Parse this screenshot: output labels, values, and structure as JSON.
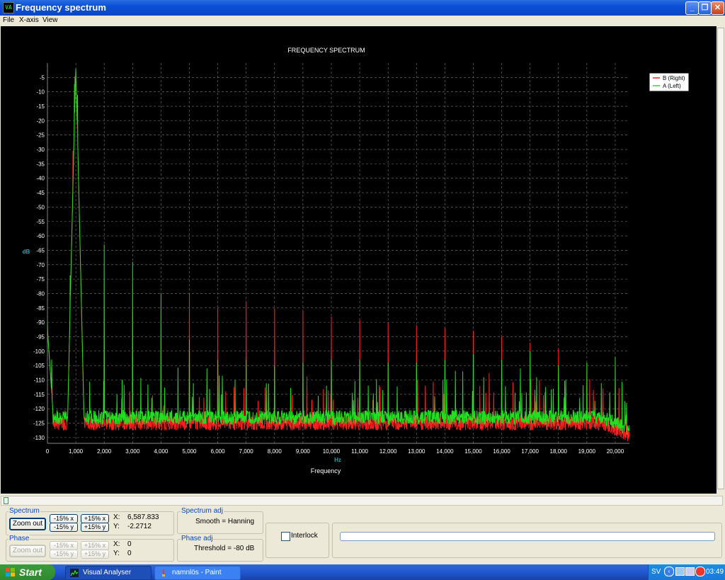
{
  "window": {
    "title": "Frequency spectrum",
    "minimize": "_",
    "maximize": "❐",
    "close": "✕",
    "app_icon": "VA"
  },
  "menu": [
    "File",
    "X-axis",
    "View"
  ],
  "chart_data": {
    "type": "line",
    "title": "FREQUENCY SPECTRUM",
    "xlabel": "Frequency",
    "x_unit": "Hz",
    "y_unit": "dB",
    "xlim": [
      0,
      20500
    ],
    "ylim": [
      -132,
      0
    ],
    "x_ticks": [
      0,
      1000,
      2000,
      3000,
      4000,
      5000,
      6000,
      7000,
      8000,
      9000,
      10000,
      11000,
      12000,
      13000,
      14000,
      15000,
      16000,
      17000,
      18000,
      19000,
      20000
    ],
    "x_tick_labels": [
      "0",
      "1,000",
      "2,000",
      "3,000",
      "4,000",
      "5,000",
      "6,000",
      "7,000",
      "8,000",
      "9,000",
      "10,000",
      "11,000",
      "12,000",
      "13,000",
      "14,000",
      "15,000",
      "16,000",
      "17,000",
      "18,000",
      "19,000",
      "20,000"
    ],
    "y_ticks": [
      -5,
      -10,
      -15,
      -20,
      -25,
      -30,
      -35,
      -40,
      -45,
      -50,
      -55,
      -60,
      -65,
      -70,
      -75,
      -80,
      -85,
      -90,
      -95,
      -100,
      -105,
      -110,
      -115,
      -120,
      -125,
      -130
    ],
    "grid": true,
    "legend_position": "top-right",
    "series": [
      {
        "name": "B (Right)",
        "color": "#ff2020",
        "noise_floor": -125,
        "peaks": [
          [
            0,
            -92
          ],
          [
            1000,
            -2
          ],
          [
            2000,
            -100
          ],
          [
            3000,
            -100
          ],
          [
            4000,
            -110
          ],
          [
            5000,
            -80
          ],
          [
            6000,
            -85
          ],
          [
            7000,
            -83
          ],
          [
            8000,
            -85
          ],
          [
            9000,
            -86
          ],
          [
            10000,
            -88
          ],
          [
            11000,
            -89
          ],
          [
            12000,
            -90
          ],
          [
            13000,
            -91
          ],
          [
            14000,
            -92
          ],
          [
            15000,
            -93
          ],
          [
            16000,
            -95
          ],
          [
            17000,
            -97
          ],
          [
            18000,
            -99
          ],
          [
            19000,
            -104
          ],
          [
            20000,
            -108
          ],
          [
            20400,
            -120
          ]
        ]
      },
      {
        "name": "A (Left)",
        "color": "#20e020",
        "noise_floor": -123,
        "peaks": [
          [
            0,
            -90
          ],
          [
            1000,
            -2
          ],
          [
            2000,
            -63
          ],
          [
            3000,
            -69
          ],
          [
            4000,
            -80
          ],
          [
            5000,
            -96
          ],
          [
            6000,
            -103
          ],
          [
            7000,
            -103
          ],
          [
            8000,
            -105
          ],
          [
            9000,
            -104
          ],
          [
            10000,
            -103
          ],
          [
            11000,
            -103
          ],
          [
            12000,
            -104
          ],
          [
            13000,
            -104
          ],
          [
            14000,
            -103
          ],
          [
            15000,
            -101
          ],
          [
            16000,
            -103
          ],
          [
            17000,
            -100
          ],
          [
            18000,
            -105
          ],
          [
            19000,
            -104
          ],
          [
            20000,
            -102
          ],
          [
            20400,
            -118
          ]
        ]
      }
    ]
  },
  "controls": {
    "spectrum_label": "Spectrum",
    "zoom_out": "Zoom out",
    "minus_x": "-15% x",
    "plus_x": "+15% x",
    "minus_y": "-15% y",
    "plus_y": "+15% y",
    "x_label": "X:",
    "x_value": "6,587.833",
    "y_label": "Y:",
    "y_value": "-2.2712",
    "phase_label": "Phase",
    "phase_x_label": "X:",
    "phase_x_value": "0",
    "phase_y_label": "Y:",
    "phase_y_value": "0",
    "spectrum_adj_label": "Spectrum adj",
    "smooth": "Smooth = Hanning",
    "phase_adj_label": "Phase adj",
    "threshold": "Threshold = -80 dB",
    "interlock": "Interlock"
  },
  "taskbar": {
    "start": "Start",
    "items": [
      {
        "label": "Visual Analyser",
        "icon": "chart-icon"
      },
      {
        "label": "namnlös - Paint",
        "icon": "paint-icon"
      }
    ],
    "lang": "SV",
    "time": "03:49"
  }
}
